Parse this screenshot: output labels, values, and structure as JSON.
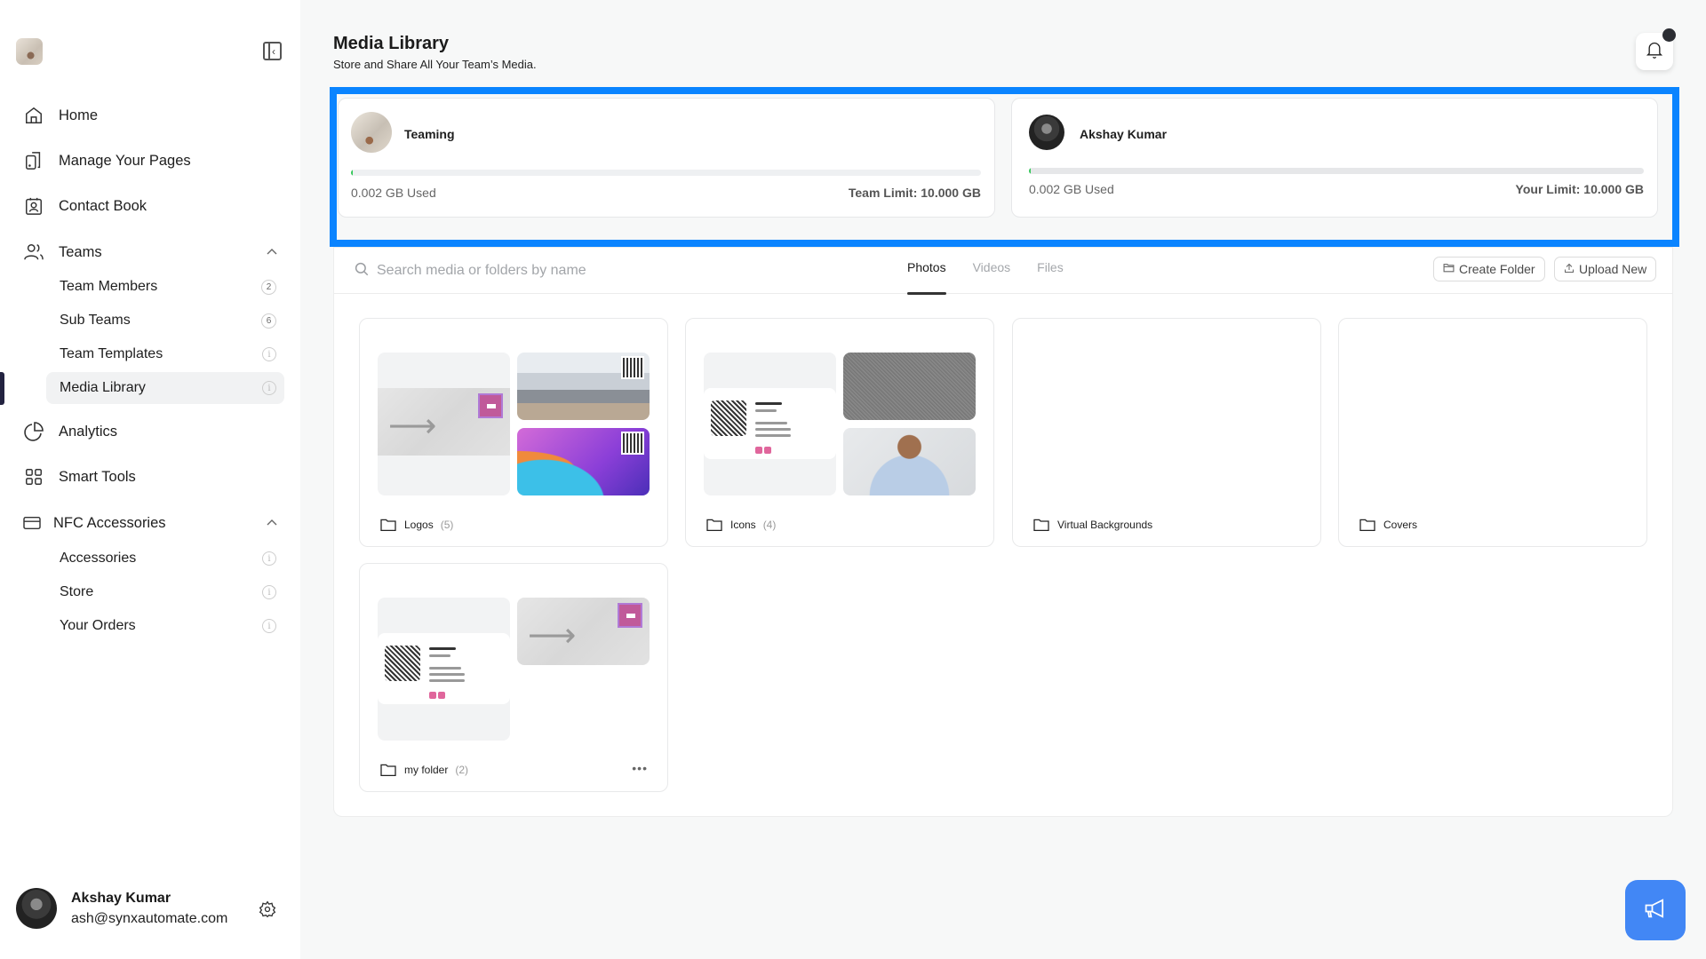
{
  "sidebar": {
    "collapse_icon": "sidebar-collapse-icon",
    "nav": {
      "home": "Home",
      "manage_pages": "Manage Your Pages",
      "contact_book": "Contact Book",
      "teams": "Teams",
      "analytics": "Analytics",
      "smart_tools": "Smart Tools",
      "nfc_accessories": "NFC Accessories"
    },
    "teams_sub": [
      {
        "label": "Team Members",
        "badge": "2"
      },
      {
        "label": "Sub Teams",
        "badge": "6"
      },
      {
        "label": "Team Templates",
        "badge": null
      },
      {
        "label": "Media Library",
        "badge": null,
        "active": true
      }
    ],
    "nfc_sub": [
      {
        "label": "Accessories"
      },
      {
        "label": "Store"
      },
      {
        "label": "Your Orders"
      }
    ],
    "info_glyph": "i",
    "chevron_up": "^",
    "profile": {
      "name": "Akshay Kumar",
      "email": "ash@synxautomate.com"
    }
  },
  "header": {
    "title": "Media Library",
    "subtitle": "Store and Share All Your Team’s Media."
  },
  "usage": {
    "team": {
      "name": "Teaming",
      "used": "0.002 GB Used",
      "limit": "Team Limit: 10.000 GB",
      "fraction": 0.0002
    },
    "user": {
      "name": "Akshay Kumar",
      "used": "0.002 GB Used",
      "limit": "Your Limit: 10.000 GB",
      "fraction": 0.0002
    }
  },
  "toolbar": {
    "search_placeholder": "Search media or folders by name",
    "tabs": [
      "Photos",
      "Videos",
      "Files"
    ],
    "active_tab": "Photos",
    "create_folder": "Create Folder",
    "upload_new": "Upload New"
  },
  "folders": [
    {
      "name": "Logos",
      "count": "(5)"
    },
    {
      "name": "Icons",
      "count": "(4)"
    },
    {
      "name": "Virtual Backgrounds",
      "count": ""
    },
    {
      "name": "Covers",
      "count": ""
    },
    {
      "name": "my folder",
      "count": "(2)",
      "menu": "•••"
    }
  ],
  "thumb_text": {
    "arrow": "⟶"
  },
  "colors": {
    "highlight": "#0a84ff",
    "fab": "#4287f5",
    "progress": "#34c759"
  }
}
